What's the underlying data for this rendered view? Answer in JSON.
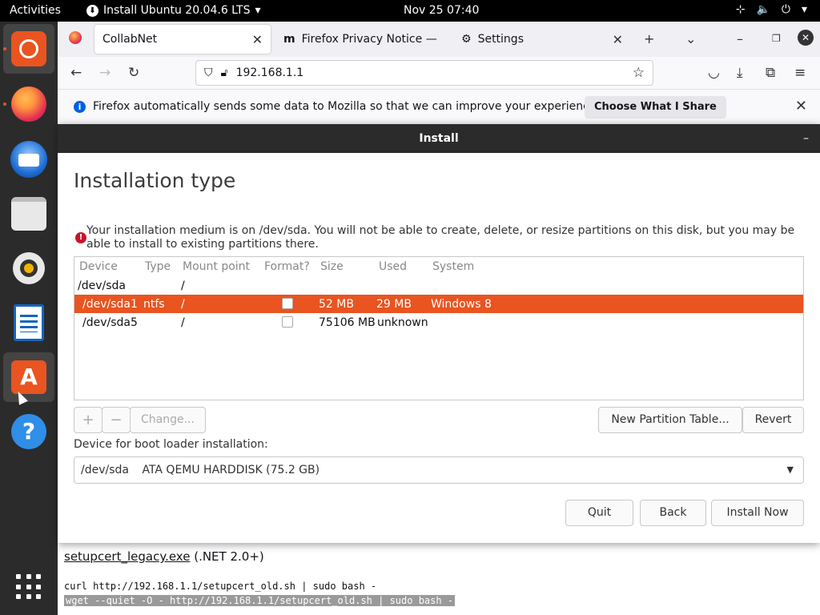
{
  "topbar": {
    "activities": "Activities",
    "installer_app": "Install Ubuntu 20.04.6 LTS",
    "clock": "Nov 25  07:40"
  },
  "dock": {
    "items": [
      "ubuntu-installer",
      "firefox",
      "thunderbird",
      "files",
      "rhythmbox",
      "libreoffice-writer",
      "ubuntu-software",
      "help",
      "show-applications"
    ]
  },
  "browser": {
    "tabs": [
      {
        "label": "CollabNet",
        "active": true
      },
      {
        "label": "Firefox Privacy Notice —",
        "active": false
      },
      {
        "label": "Settings",
        "active": false
      }
    ],
    "url": "192.168.1.1",
    "notification": {
      "message": "Firefox automatically sends some data to Mozilla so that we can improve your experience.",
      "button": "Choose What I Share"
    },
    "page": {
      "link_text": "setupcert_legacy.exe",
      "link_suffix": " (.NET 2.0+)",
      "code_line_1": "curl http://192.168.1.1/setupcert_old.sh | sudo bash -",
      "code_line_2": "wget --quiet -O - http://192.168.1.1/setupcert_old.sh | sudo bash -"
    }
  },
  "installer": {
    "window_title": "Install",
    "heading": "Installation type",
    "warning": "Your installation medium is on /dev/sda. You will not be able to create, delete, or resize partitions on this disk, but you may be able to install to existing partitions there.",
    "table": {
      "columns": [
        "Device",
        "Type",
        "Mount point",
        "Format?",
        "Size",
        "Used",
        "System"
      ],
      "rows": [
        {
          "device": "/dev/sda",
          "type": "",
          "mount": "/",
          "format": null,
          "size": "",
          "used": "",
          "system": ""
        },
        {
          "device": "/dev/sda1",
          "type": "ntfs",
          "mount": "/",
          "format": false,
          "size": "52 MB",
          "used": "29 MB",
          "system": "Windows 8"
        },
        {
          "device": "/dev/sda5",
          "type": "",
          "mount": "/",
          "format": false,
          "size": "75106 MB",
          "used": "unknown",
          "system": ""
        }
      ]
    },
    "buttons": {
      "add": "+",
      "remove": "−",
      "change": "Change...",
      "new_table": "New Partition Table...",
      "revert": "Revert",
      "quit": "Quit",
      "back": "Back",
      "install": "Install Now"
    },
    "boot_label": "Device for boot loader installation:",
    "boot_device": "/dev/sda",
    "boot_desc": "ATA QEMU HARDDISK (75.2 GB)"
  },
  "colors": {
    "accent": "#e95420",
    "topbar": "#000000",
    "dock": "#2b2b2b"
  }
}
